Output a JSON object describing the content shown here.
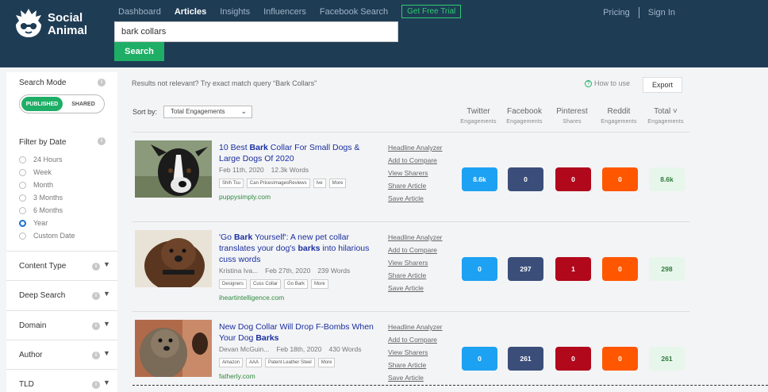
{
  "brand": {
    "name_line1": "Social",
    "name_line2": "Animal"
  },
  "nav": {
    "items": [
      "Dashboard",
      "Articles",
      "Insights",
      "Influencers",
      "Facebook Search"
    ],
    "trial": "Get Free Trial",
    "pricing": "Pricing",
    "signin": "Sign In"
  },
  "search": {
    "value": "bark collars",
    "button": "Search"
  },
  "sidebar": {
    "search_mode": "Search Mode",
    "mode_on": "PUBLISHED",
    "mode_off": "SHARED",
    "filter_date": "Filter by Date",
    "dates": [
      "24 Hours",
      "Week",
      "Month",
      "3 Months",
      "6 Months",
      "Year",
      "Custom Date"
    ],
    "selected_date": "Year",
    "sections": [
      "Content Type",
      "Deep Search",
      "Domain",
      "Author",
      "TLD"
    ]
  },
  "main": {
    "hint": "Results not relevant? Try exact match query “Bark Collars”",
    "howto": "How to use",
    "export": "Export",
    "sort_label": "Sort by:",
    "sort_value": "Total Engagements",
    "columns": [
      {
        "name": "Twitter",
        "sub": "Engagements"
      },
      {
        "name": "Facebook",
        "sub": "Engagements"
      },
      {
        "name": "Pinterest",
        "sub": "Shares"
      },
      {
        "name": "Reddit",
        "sub": "Engagements"
      },
      {
        "name": "Total ˅",
        "sub": "Engagements"
      }
    ],
    "actions": [
      "Headline Analyzer",
      "Add to Compare",
      "View Sharers",
      "Share Article",
      "Save Article"
    ]
  },
  "articles": [
    {
      "title": "10 Best Bark Collar For Small Dogs & Large Dogs Of 2020",
      "date": "Feb 11th, 2020",
      "words": "12.3k Words",
      "tags": [
        "Shih Tsu",
        "Can PricesImagesReviews",
        "Ive",
        "More"
      ],
      "domain": "puppysimply.com",
      "twitter": "8.6k",
      "facebook": "0",
      "pinterest": "0",
      "reddit": "0",
      "total": "8.6k"
    },
    {
      "title": "'Go Bark Yourself': A new pet collar translates your dog's barks into hilarious cuss words",
      "author": "Kristina Iva...",
      "date": "Feb 27th, 2020",
      "words": "239 Words",
      "tags": [
        "Designers",
        "Cuss Collar",
        "Go Bark",
        "More"
      ],
      "domain": "iheartintelligence.com",
      "twitter": "0",
      "facebook": "297",
      "pinterest": "1",
      "reddit": "0",
      "total": "298"
    },
    {
      "title": "New Dog Collar Will Drop F-Bombs When Your Dog Barks",
      "author": "Devan McGuin...",
      "date": "Feb 18th, 2020",
      "words": "430 Words",
      "tags": [
        "Amazon",
        "AAA",
        "Patent Leather Steel",
        "More"
      ],
      "domain": "fatherly.com",
      "twitter": "0",
      "facebook": "261",
      "pinterest": "0",
      "reddit": "0",
      "total": "261"
    }
  ],
  "colors": {
    "header": "#1f3c55",
    "green": "#1fae66",
    "twitter": "#1da1f2",
    "facebook": "#3b4e7a",
    "pinterest": "#b1081c",
    "reddit": "#ff5700"
  }
}
